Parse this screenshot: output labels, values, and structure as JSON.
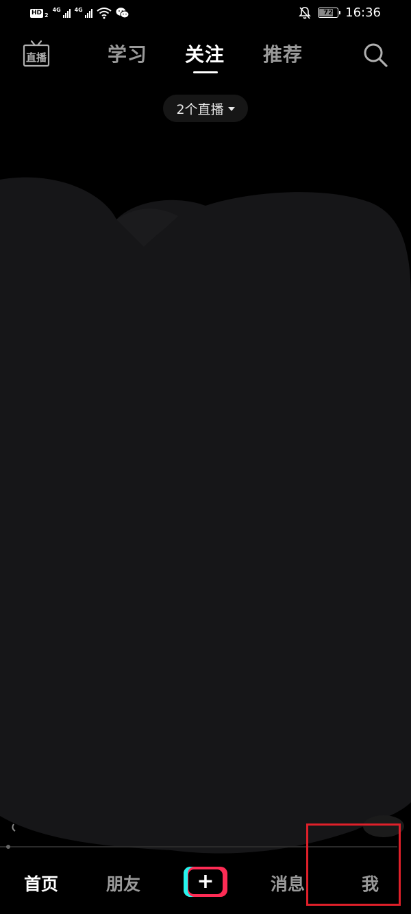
{
  "status_bar": {
    "hd_label": "HD",
    "hd_sub": "2",
    "signal_1_label": "4G",
    "signal_2_label": "4G",
    "battery": "72",
    "time": "16:36"
  },
  "top_nav": {
    "live_icon_label": "直播",
    "tabs": [
      {
        "label": "学习",
        "active": false
      },
      {
        "label": "关注",
        "active": true
      },
      {
        "label": "推荐",
        "active": false
      }
    ]
  },
  "live_pill": {
    "label": "2个直播"
  },
  "bottom_nav": {
    "items": [
      {
        "label": "首页",
        "active": true
      },
      {
        "label": "朋友",
        "active": false
      },
      {
        "label": "+",
        "active": false
      },
      {
        "label": "消息",
        "active": false
      },
      {
        "label": "我",
        "active": false
      }
    ]
  },
  "colors": {
    "background": "#000000",
    "active_text": "#ffffff",
    "inactive_text": "#9a9a9a",
    "accent_cyan": "#25f4ee",
    "accent_red": "#fe2c55",
    "highlight_box": "#e0202a"
  }
}
